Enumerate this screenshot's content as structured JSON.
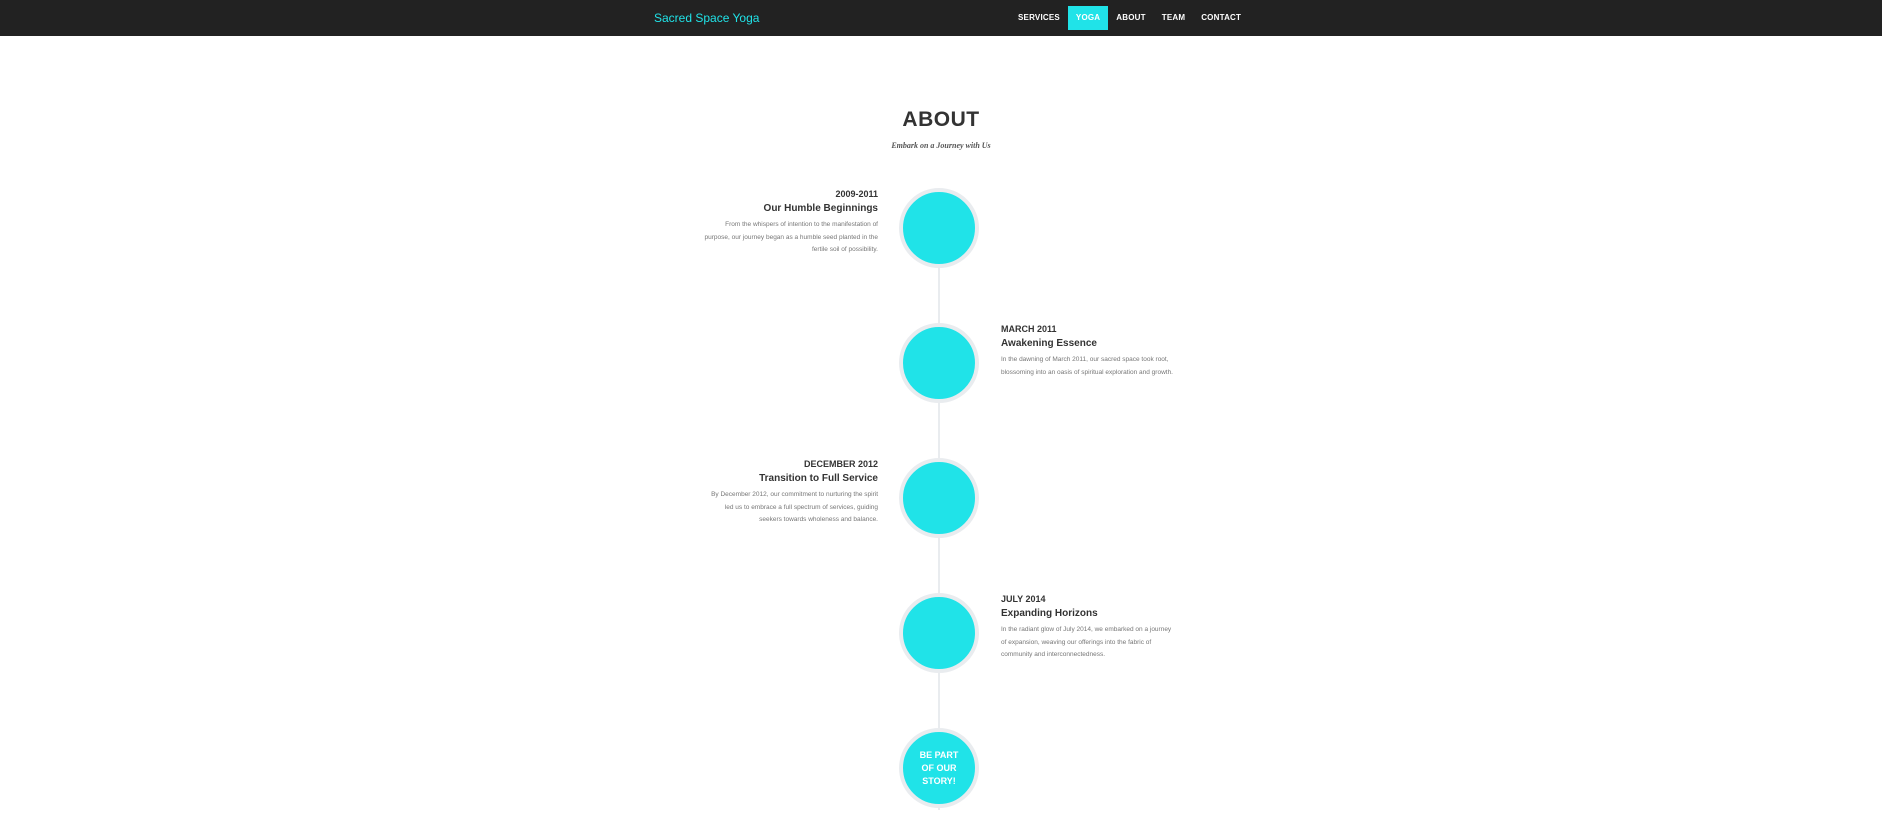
{
  "navbar": {
    "brand": "Sacred Space Yoga",
    "items": [
      {
        "label": "SERVICES"
      },
      {
        "label": "YOGA"
      },
      {
        "label": "ABOUT"
      },
      {
        "label": "TEAM"
      },
      {
        "label": "CONTACT"
      }
    ],
    "active_item": "YOGA"
  },
  "about": {
    "heading": "ABOUT",
    "subheading": "Embark on a Journey with Us",
    "timeline": [
      {
        "date": "2009-2011",
        "title": "Our Humble Beginnings",
        "description": "From the whispers of intention to the manifestation of purpose, our journey began as a humble seed planted in the fertile soil of possibility."
      },
      {
        "date": "MARCH 2011",
        "title": "Awakening Essence",
        "description": "In the dawning of March 2011, our sacred space took root, blossoming into an oasis of spiritual exploration and growth."
      },
      {
        "date": "DECEMBER 2012",
        "title": "Transition to Full Service",
        "description": "By December 2012, our commitment to nurturing the spirit led us to embrace a full spectrum of services, guiding seekers towards wholeness and balance."
      },
      {
        "date": "JULY 2014",
        "title": "Expanding Horizons",
        "description": "In the radiant glow of July 2014, we embarked on a journey of expansion, weaving our offerings into the fabric of community and interconnectedness."
      }
    ],
    "final_circle": "BE PART OF OUR STORY!"
  },
  "colors": {
    "accent": "#20e3e8",
    "navbar_bg": "#222222",
    "timeline_line": "#e9ecef"
  }
}
